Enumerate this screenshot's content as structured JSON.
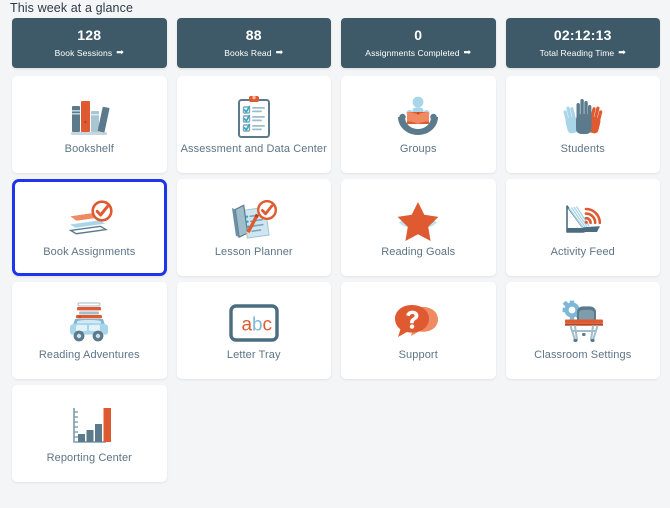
{
  "header": {
    "title": "This week at a glance"
  },
  "colors": {
    "page_background": "#f4f5f7",
    "stat_card_background": "#3e5a68",
    "tile_background": "#ffffff",
    "tile_label": "#5d7486",
    "selection_outline": "#1f34ed",
    "accent_orange": "#e05a31",
    "accent_slate": "#5b7b8c",
    "accent_light_blue": "#a9d5e8"
  },
  "stats": [
    {
      "value": "128",
      "label": "Book Sessions",
      "arrow": "➡",
      "icon": "arrow-right-icon"
    },
    {
      "value": "88",
      "label": "Books Read",
      "arrow": "➡",
      "icon": "arrow-right-icon"
    },
    {
      "value": "0",
      "label": "Assignments Completed",
      "arrow": "➡",
      "icon": "arrow-right-icon"
    },
    {
      "value": "02:12:13",
      "label": "Total Reading Time",
      "arrow": "➡",
      "icon": "arrow-right-icon"
    }
  ],
  "tiles": [
    {
      "label": "Bookshelf",
      "icon": "bookshelf-icon",
      "selected": false
    },
    {
      "label": "Assessment and Data Center",
      "icon": "clipboard-checklist-icon",
      "selected": false
    },
    {
      "label": "Groups",
      "icon": "group-reading-icon",
      "selected": false
    },
    {
      "label": "Students",
      "icon": "raised-hands-icon",
      "selected": false
    },
    {
      "label": "Book Assignments",
      "icon": "books-check-icon",
      "selected": true
    },
    {
      "label": "Lesson Planner",
      "icon": "lesson-plan-check-icon",
      "selected": false
    },
    {
      "label": "Reading Goals",
      "icon": "star-icon",
      "selected": false
    },
    {
      "label": "Activity Feed",
      "icon": "book-rss-icon",
      "selected": false
    },
    {
      "label": "Reading Adventures",
      "icon": "book-car-icon",
      "selected": false
    },
    {
      "label": "Letter Tray",
      "icon": "abc-board-icon",
      "selected": false
    },
    {
      "label": "Support",
      "icon": "question-chat-icon",
      "selected": false
    },
    {
      "label": "Classroom Settings",
      "icon": "desk-gear-icon",
      "selected": false
    },
    {
      "label": "Reporting Center",
      "icon": "bar-chart-icon",
      "selected": false
    }
  ]
}
